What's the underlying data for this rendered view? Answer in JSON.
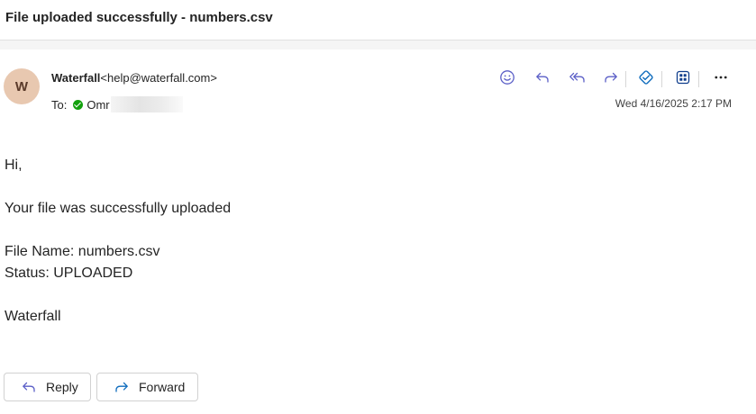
{
  "subject": "File uploaded successfully - numbers.csv",
  "sender": {
    "avatar_initial": "W",
    "name": "Waterfall",
    "email": "<help@waterfall.com>"
  },
  "recipients": {
    "label": "To:",
    "name": "Omr"
  },
  "date": "Wed 4/16/2025 2:17 PM",
  "toolbar": {
    "icons": [
      "smiley-icon",
      "reply-icon",
      "reply-all-icon",
      "forward-icon",
      "loop-icon",
      "apps-icon",
      "more-icon"
    ],
    "more_label": "···"
  },
  "body": {
    "greeting": "Hi,",
    "line1": "Your file was successfully uploaded",
    "file_name": "File Name: numbers.csv",
    "status": "Status: UPLOADED",
    "signature": "Waterfall"
  },
  "actions": {
    "reply_label": "Reply",
    "forward_label": "Forward"
  },
  "colors": {
    "accent": "#5b5fc7",
    "presence": "#13a10e",
    "loop": "#0f6cbd"
  }
}
